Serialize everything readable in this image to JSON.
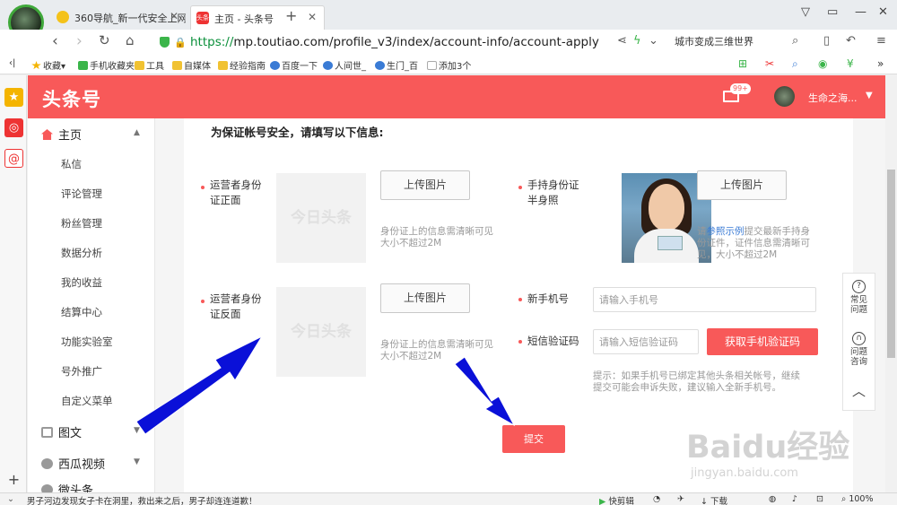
{
  "browser": {
    "tabs": [
      {
        "label": "360导航_新一代安全上网导"
      },
      {
        "label": "主页 - 头条号",
        "icon_text": "头条"
      }
    ],
    "url_protocol": "https://",
    "url_rest": "mp.toutiao.com/profile_v3/index/account-info/account-apply",
    "search_text": "城市变成三维世界",
    "bookmarks": [
      "收藏",
      "手机收藏夹",
      "工具",
      "自媒体",
      "经验指南",
      "百度一下",
      "人间世_",
      "生门_百",
      "添加3个"
    ],
    "status_news": "男子河边发现女子卡在洞里，救出来之后，男子却连连道歉！",
    "status_right": [
      "快剪辑",
      "下载",
      "100%"
    ]
  },
  "site": {
    "logo": "头条号",
    "mail_badge": "99+",
    "username": "生命之海...",
    "nav": {
      "home": "主页",
      "sub_items": [
        "私信",
        "评论管理",
        "粉丝管理",
        "数据分析",
        "我的收益",
        "结算中心",
        "功能实验室",
        "号外推广",
        "自定义菜单"
      ],
      "images": "图文",
      "video": "西瓜视频",
      "partial": "微头条"
    }
  },
  "form": {
    "title": "为保证帐号安全，请填写以下信息:",
    "id_front": "运营者身份证正面",
    "id_back": "运营者身份证反面",
    "handheld": "手持身份证半身照",
    "placeholder_text": "今日头条",
    "upload_label": "上传图片",
    "id_hint": "身份证上的信息需清晰可见",
    "size_hint": "大小不超过2M",
    "handheld_hint_pre": "请",
    "handheld_hint_link": "参照示例",
    "handheld_hint_post": "提交最新手持身份证件，证件信息需清晰可见，大小不超过2M",
    "new_phone": "新手机号",
    "phone_placeholder": "请输入手机号",
    "sms_label": "短信验证码",
    "sms_placeholder": "请输入短信验证码",
    "get_code": "获取手机验证码",
    "phone_tip": "提示：如果手机号已绑定其他头条相关帐号，继续提交可能会申诉失败，建议输入全新手机号。",
    "submit": "提交"
  },
  "float_panel": {
    "faq": "常见问题",
    "consult": "问题咨询"
  },
  "watermark": {
    "main": "Baidu经验",
    "sub": "jingyan.baidu.com"
  },
  "colors": {
    "brand": "#f85959",
    "arrow": "#0a10d8"
  }
}
